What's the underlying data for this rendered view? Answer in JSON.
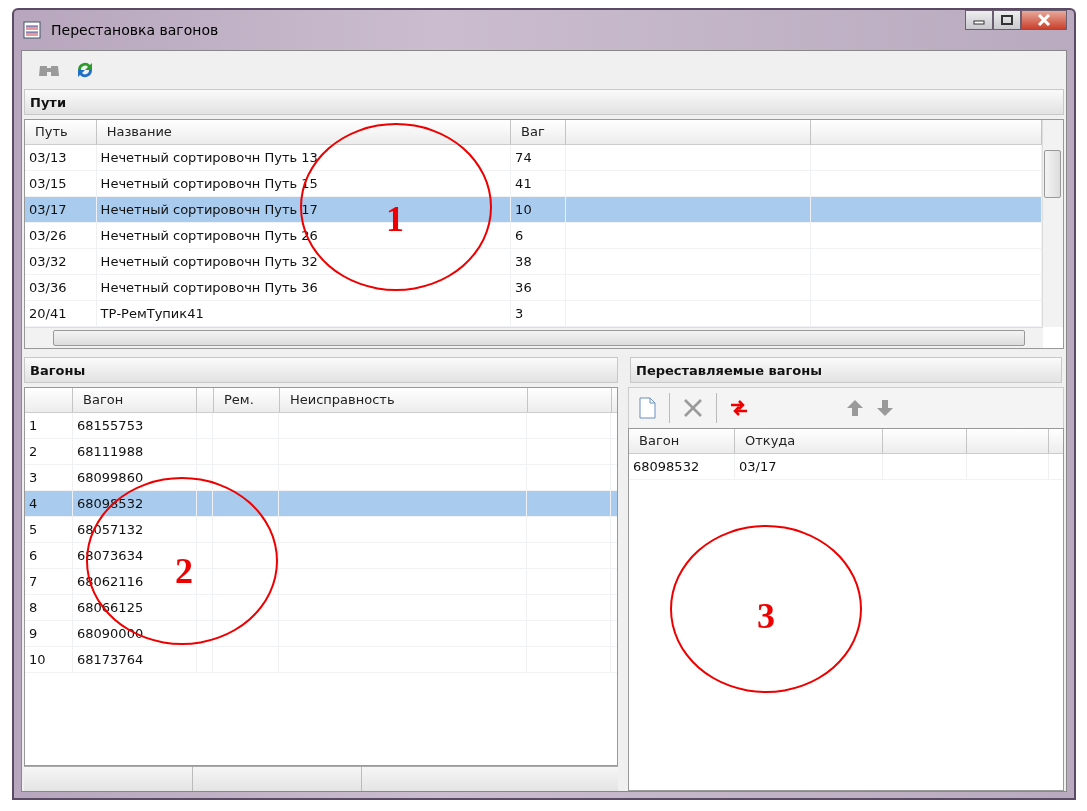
{
  "window": {
    "title": "Перестановка вагонов"
  },
  "toolbar": [
    {
      "kind": "find",
      "disabled": true
    },
    {
      "kind": "refresh",
      "disabled": false
    }
  ],
  "tracks": {
    "title": "Пути",
    "columns": [
      "Путь",
      "Название",
      "Ваг"
    ],
    "rows": [
      {
        "cells": [
          "03/13",
          "Нечетный сортировочн Путь 13",
          "74"
        ],
        "selected": false
      },
      {
        "cells": [
          "03/15",
          "Нечетный сортировочн Путь 15",
          "41"
        ],
        "selected": false
      },
      {
        "cells": [
          "03/17",
          "Нечетный сортировочн Путь 17",
          "10"
        ],
        "selected": true
      },
      {
        "cells": [
          "03/26",
          "Нечетный сортировочн Путь 26",
          "6"
        ],
        "selected": false
      },
      {
        "cells": [
          "03/32",
          "Нечетный сортировочн Путь 32",
          "38"
        ],
        "selected": false
      },
      {
        "cells": [
          "03/36",
          "Нечетный сортировочн Путь 36",
          "36"
        ],
        "selected": false
      },
      {
        "cells": [
          "20/41",
          "ТР-РемТупик41",
          "3"
        ],
        "selected": false
      }
    ]
  },
  "wagons": {
    "title": "Вагоны",
    "columns": [
      "Вагон",
      "Рем.",
      "Неисправность"
    ],
    "rows": [
      {
        "number": "1",
        "cells": [
          "68155753"
        ],
        "selected": false
      },
      {
        "number": "2",
        "cells": [
          "68111988"
        ],
        "selected": false
      },
      {
        "number": "3",
        "cells": [
          "68099860"
        ],
        "selected": false
      },
      {
        "number": "4",
        "cells": [
          "68098532"
        ],
        "selected": true
      },
      {
        "number": "5",
        "cells": [
          "68057132"
        ],
        "selected": false
      },
      {
        "number": "6",
        "cells": [
          "68073634"
        ],
        "selected": false
      },
      {
        "number": "7",
        "cells": [
          "68062116"
        ],
        "selected": false
      },
      {
        "number": "8",
        "cells": [
          "68066125"
        ],
        "selected": false
      },
      {
        "number": "9",
        "cells": [
          "68090000"
        ],
        "selected": false
      },
      {
        "number": "10",
        "cells": [
          "68173764"
        ],
        "selected": false
      }
    ]
  },
  "moved": {
    "title": "Переставляемые вагоны",
    "toolbar": [
      {
        "kind": "new",
        "disabled": false
      },
      {
        "kind": "delete",
        "disabled": true
      },
      {
        "kind": "swap",
        "disabled": false
      },
      {
        "kind": "up",
        "disabled": true
      },
      {
        "kind": "down",
        "disabled": true
      }
    ],
    "columns": [
      "Вагон",
      "Откуда"
    ],
    "rows": [
      {
        "cells": [
          "68098532",
          "03/17"
        ],
        "selected": false
      }
    ]
  },
  "annotations": [
    {
      "label": "1"
    },
    {
      "label": "2"
    },
    {
      "label": "3"
    }
  ]
}
